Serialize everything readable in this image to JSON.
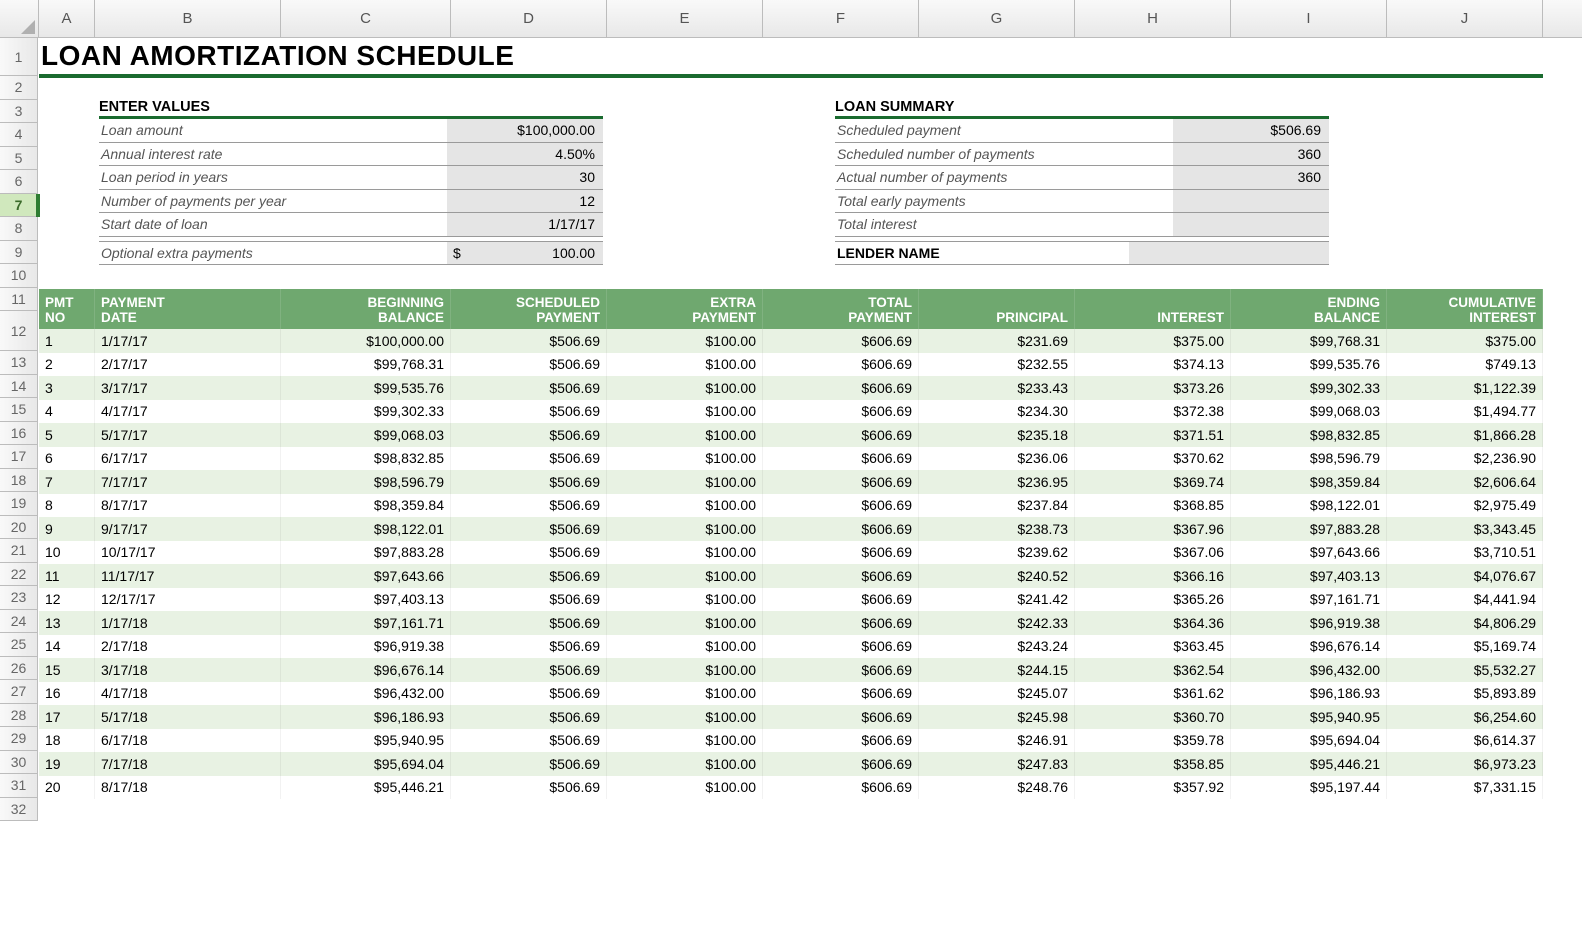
{
  "title": "LOAN AMORTIZATION SCHEDULE",
  "columns": [
    "A",
    "B",
    "C",
    "D",
    "E",
    "F",
    "G",
    "H",
    "I",
    "J"
  ],
  "row_numbers": [
    1,
    2,
    3,
    4,
    5,
    6,
    7,
    8,
    9,
    10,
    11,
    12,
    13,
    14,
    15,
    16,
    17,
    18,
    19,
    20,
    21,
    22,
    23,
    24,
    25,
    26,
    27,
    28,
    29,
    30,
    31,
    32
  ],
  "selected_row": 7,
  "enter_values": {
    "heading": "ENTER VALUES",
    "rows": [
      {
        "label": "Loan amount",
        "value": "$100,000.00"
      },
      {
        "label": "Annual interest rate",
        "value": "4.50%"
      },
      {
        "label": "Loan period in years",
        "value": "30"
      },
      {
        "label": "Number of payments per year",
        "value": "12"
      },
      {
        "label": "Start date of loan",
        "value": "1/17/17"
      }
    ]
  },
  "optional_extra": {
    "label": "Optional extra payments",
    "currency": "$",
    "value": "100.00"
  },
  "loan_summary": {
    "heading": "LOAN SUMMARY",
    "rows": [
      {
        "label": "Scheduled payment",
        "value": "$506.69"
      },
      {
        "label": "Scheduled number of payments",
        "value": "360"
      },
      {
        "label": "Actual number of payments",
        "value": "360"
      },
      {
        "label": "Total early payments",
        "value": ""
      },
      {
        "label": "Total interest",
        "value": ""
      }
    ]
  },
  "lender": {
    "label": "LENDER NAME",
    "value": ""
  },
  "amort": {
    "headers": [
      "PMT NO",
      "PAYMENT DATE",
      "BEGINNING BALANCE",
      "SCHEDULED PAYMENT",
      "EXTRA PAYMENT",
      "TOTAL PAYMENT",
      "PRINCIPAL",
      "INTEREST",
      "ENDING BALANCE",
      "CUMULATIVE INTEREST"
    ],
    "rows": [
      {
        "no": "1",
        "date": "1/17/17",
        "begin": "$100,000.00",
        "sched": "$506.69",
        "extra": "$100.00",
        "total": "$606.69",
        "principal": "$231.69",
        "interest": "$375.00",
        "end": "$99,768.31",
        "cum": "$375.00"
      },
      {
        "no": "2",
        "date": "2/17/17",
        "begin": "$99,768.31",
        "sched": "$506.69",
        "extra": "$100.00",
        "total": "$606.69",
        "principal": "$232.55",
        "interest": "$374.13",
        "end": "$99,535.76",
        "cum": "$749.13"
      },
      {
        "no": "3",
        "date": "3/17/17",
        "begin": "$99,535.76",
        "sched": "$506.69",
        "extra": "$100.00",
        "total": "$606.69",
        "principal": "$233.43",
        "interest": "$373.26",
        "end": "$99,302.33",
        "cum": "$1,122.39"
      },
      {
        "no": "4",
        "date": "4/17/17",
        "begin": "$99,302.33",
        "sched": "$506.69",
        "extra": "$100.00",
        "total": "$606.69",
        "principal": "$234.30",
        "interest": "$372.38",
        "end": "$99,068.03",
        "cum": "$1,494.77"
      },
      {
        "no": "5",
        "date": "5/17/17",
        "begin": "$99,068.03",
        "sched": "$506.69",
        "extra": "$100.00",
        "total": "$606.69",
        "principal": "$235.18",
        "interest": "$371.51",
        "end": "$98,832.85",
        "cum": "$1,866.28"
      },
      {
        "no": "6",
        "date": "6/17/17",
        "begin": "$98,832.85",
        "sched": "$506.69",
        "extra": "$100.00",
        "total": "$606.69",
        "principal": "$236.06",
        "interest": "$370.62",
        "end": "$98,596.79",
        "cum": "$2,236.90"
      },
      {
        "no": "7",
        "date": "7/17/17",
        "begin": "$98,596.79",
        "sched": "$506.69",
        "extra": "$100.00",
        "total": "$606.69",
        "principal": "$236.95",
        "interest": "$369.74",
        "end": "$98,359.84",
        "cum": "$2,606.64"
      },
      {
        "no": "8",
        "date": "8/17/17",
        "begin": "$98,359.84",
        "sched": "$506.69",
        "extra": "$100.00",
        "total": "$606.69",
        "principal": "$237.84",
        "interest": "$368.85",
        "end": "$98,122.01",
        "cum": "$2,975.49"
      },
      {
        "no": "9",
        "date": "9/17/17",
        "begin": "$98,122.01",
        "sched": "$506.69",
        "extra": "$100.00",
        "total": "$606.69",
        "principal": "$238.73",
        "interest": "$367.96",
        "end": "$97,883.28",
        "cum": "$3,343.45"
      },
      {
        "no": "10",
        "date": "10/17/17",
        "begin": "$97,883.28",
        "sched": "$506.69",
        "extra": "$100.00",
        "total": "$606.69",
        "principal": "$239.62",
        "interest": "$367.06",
        "end": "$97,643.66",
        "cum": "$3,710.51"
      },
      {
        "no": "11",
        "date": "11/17/17",
        "begin": "$97,643.66",
        "sched": "$506.69",
        "extra": "$100.00",
        "total": "$606.69",
        "principal": "$240.52",
        "interest": "$366.16",
        "end": "$97,403.13",
        "cum": "$4,076.67"
      },
      {
        "no": "12",
        "date": "12/17/17",
        "begin": "$97,403.13",
        "sched": "$506.69",
        "extra": "$100.00",
        "total": "$606.69",
        "principal": "$241.42",
        "interest": "$365.26",
        "end": "$97,161.71",
        "cum": "$4,441.94"
      },
      {
        "no": "13",
        "date": "1/17/18",
        "begin": "$97,161.71",
        "sched": "$506.69",
        "extra": "$100.00",
        "total": "$606.69",
        "principal": "$242.33",
        "interest": "$364.36",
        "end": "$96,919.38",
        "cum": "$4,806.29"
      },
      {
        "no": "14",
        "date": "2/17/18",
        "begin": "$96,919.38",
        "sched": "$506.69",
        "extra": "$100.00",
        "total": "$606.69",
        "principal": "$243.24",
        "interest": "$363.45",
        "end": "$96,676.14",
        "cum": "$5,169.74"
      },
      {
        "no": "15",
        "date": "3/17/18",
        "begin": "$96,676.14",
        "sched": "$506.69",
        "extra": "$100.00",
        "total": "$606.69",
        "principal": "$244.15",
        "interest": "$362.54",
        "end": "$96,432.00",
        "cum": "$5,532.27"
      },
      {
        "no": "16",
        "date": "4/17/18",
        "begin": "$96,432.00",
        "sched": "$506.69",
        "extra": "$100.00",
        "total": "$606.69",
        "principal": "$245.07",
        "interest": "$361.62",
        "end": "$96,186.93",
        "cum": "$5,893.89"
      },
      {
        "no": "17",
        "date": "5/17/18",
        "begin": "$96,186.93",
        "sched": "$506.69",
        "extra": "$100.00",
        "total": "$606.69",
        "principal": "$245.98",
        "interest": "$360.70",
        "end": "$95,940.95",
        "cum": "$6,254.60"
      },
      {
        "no": "18",
        "date": "6/17/18",
        "begin": "$95,940.95",
        "sched": "$506.69",
        "extra": "$100.00",
        "total": "$606.69",
        "principal": "$246.91",
        "interest": "$359.78",
        "end": "$95,694.04",
        "cum": "$6,614.37"
      },
      {
        "no": "19",
        "date": "7/17/18",
        "begin": "$95,694.04",
        "sched": "$506.69",
        "extra": "$100.00",
        "total": "$606.69",
        "principal": "$247.83",
        "interest": "$358.85",
        "end": "$95,446.21",
        "cum": "$6,973.23"
      },
      {
        "no": "20",
        "date": "8/17/18",
        "begin": "$95,446.21",
        "sched": "$506.69",
        "extra": "$100.00",
        "total": "$606.69",
        "principal": "$248.76",
        "interest": "$357.92",
        "end": "$95,197.44",
        "cum": "$7,331.15"
      }
    ]
  }
}
